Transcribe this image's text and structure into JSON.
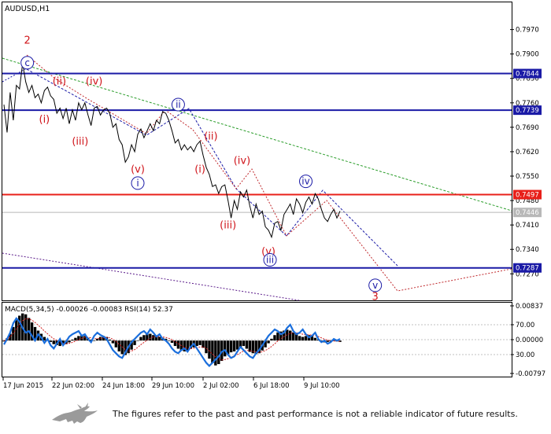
{
  "chart_data": [
    {
      "type": "line",
      "title": "AUDUSD,H1",
      "series_kind": "price (H1 candles, rendered as line)",
      "x_tick_labels": [
        "17 Jun 2015",
        "22 Jun 02:00",
        "24 Jun 18:00",
        "29 Jun 10:00",
        "2 Jul 02:00",
        "6 Jul 18:00",
        "9 Jul 10:00"
      ],
      "y_tick_labels": [
        "0.7970",
        "0.7900",
        "0.7830",
        "0.7760",
        "0.7690",
        "0.7620",
        "0.7550",
        "0.7480",
        "0.7410",
        "0.7340",
        "0.7270"
      ],
      "y_ticks": [
        0.797,
        0.79,
        0.783,
        0.776,
        0.769,
        0.762,
        0.755,
        0.748,
        0.741,
        0.734,
        0.727
      ],
      "ylim": [
        0.7194,
        0.8048
      ],
      "xlim": [
        0,
        100
      ],
      "price_path": [
        [
          0,
          0.7755
        ],
        [
          1,
          0.7675
        ],
        [
          2,
          0.779
        ],
        [
          3,
          0.771
        ],
        [
          4,
          0.781
        ],
        [
          5,
          0.78
        ],
        [
          6,
          0.7873
        ],
        [
          7,
          0.782
        ],
        [
          8,
          0.779
        ],
        [
          9,
          0.781
        ],
        [
          10,
          0.7775
        ],
        [
          11,
          0.7785
        ],
        [
          12,
          0.776
        ],
        [
          13,
          0.7795
        ],
        [
          14,
          0.7805
        ],
        [
          15,
          0.778
        ],
        [
          16,
          0.777
        ],
        [
          17,
          0.773
        ],
        [
          18,
          0.7745
        ],
        [
          19,
          0.7715
        ],
        [
          20,
          0.7745
        ],
        [
          21,
          0.77
        ],
        [
          22,
          0.774
        ],
        [
          23,
          0.771
        ],
        [
          24,
          0.776
        ],
        [
          25,
          0.774
        ],
        [
          26,
          0.776
        ],
        [
          27,
          0.7725
        ],
        [
          28,
          0.7695
        ],
        [
          29,
          0.7745
        ],
        [
          30,
          0.775
        ],
        [
          31,
          0.7725
        ],
        [
          32,
          0.774
        ],
        [
          33,
          0.7745
        ],
        [
          34,
          0.773
        ],
        [
          35,
          0.769
        ],
        [
          36,
          0.77
        ],
        [
          37,
          0.7655
        ],
        [
          38,
          0.764
        ],
        [
          39,
          0.759
        ],
        [
          40,
          0.7605
        ],
        [
          41,
          0.764
        ],
        [
          42,
          0.762
        ],
        [
          43,
          0.767
        ],
        [
          44,
          0.7685
        ],
        [
          45,
          0.766
        ],
        [
          46,
          0.768
        ],
        [
          47,
          0.77
        ],
        [
          48,
          0.768
        ],
        [
          49,
          0.771
        ],
        [
          50,
          0.77
        ],
        [
          51,
          0.7735
        ],
        [
          52,
          0.773
        ],
        [
          53,
          0.771
        ],
        [
          54,
          0.768
        ],
        [
          55,
          0.7645
        ],
        [
          56,
          0.7655
        ],
        [
          57,
          0.7625
        ],
        [
          58,
          0.764
        ],
        [
          59,
          0.7625
        ],
        [
          60,
          0.7635
        ],
        [
          61,
          0.762
        ],
        [
          62,
          0.764
        ],
        [
          63,
          0.765
        ],
        [
          64,
          0.761
        ],
        [
          65,
          0.7575
        ],
        [
          66,
          0.7555
        ],
        [
          67,
          0.752
        ],
        [
          68,
          0.7525
        ],
        [
          69,
          0.75
        ],
        [
          70,
          0.752
        ],
        [
          71,
          0.7525
        ],
        [
          72,
          0.748
        ],
        [
          73,
          0.743
        ],
        [
          74,
          0.748
        ],
        [
          75,
          0.7455
        ],
        [
          76,
          0.7505
        ],
        [
          77,
          0.749
        ],
        [
          78,
          0.751
        ],
        [
          79,
          0.7465
        ],
        [
          80,
          0.743
        ],
        [
          81,
          0.747
        ],
        [
          82,
          0.744
        ],
        [
          83,
          0.745
        ],
        [
          84,
          0.7405
        ],
        [
          85,
          0.7395
        ],
        [
          86,
          0.7375
        ],
        [
          87,
          0.7415
        ],
        [
          88,
          0.742
        ],
        [
          89,
          0.7395
        ],
        [
          90,
          0.744
        ],
        [
          91,
          0.7455
        ],
        [
          92,
          0.747
        ],
        [
          93,
          0.744
        ],
        [
          94,
          0.7485
        ],
        [
          95,
          0.747
        ],
        [
          96,
          0.7445
        ],
        [
          97,
          0.7475
        ],
        [
          98,
          0.749
        ],
        [
          99,
          0.747
        ],
        [
          100,
          0.75
        ],
        [
          101,
          0.7485
        ],
        [
          102,
          0.7455
        ],
        [
          103,
          0.743
        ],
        [
          104,
          0.742
        ],
        [
          105,
          0.744
        ],
        [
          106,
          0.7455
        ],
        [
          107,
          0.743
        ],
        [
          108,
          0.745
        ]
      ],
      "horizontal_levels": [
        {
          "value": 0.7844,
          "label": "0.7844",
          "color": "#1a1aa6"
        },
        {
          "value": 0.7739,
          "label": "0.7739",
          "color": "#1a1aa6"
        },
        {
          "value": 0.7497,
          "label": "0.7497",
          "color": "#e8201a"
        },
        {
          "value": 0.7446,
          "label": "0.7446",
          "color": "#b8b8b8"
        },
        {
          "value": 0.7287,
          "label": "0.7287",
          "color": "#1a1aa6"
        }
      ],
      "wave_labels_red": [
        {
          "text": "2",
          "x": 7.5,
          "y": 0.793
        },
        {
          "text": "(ii)",
          "x": 17.8,
          "y": 0.7813
        },
        {
          "text": "(iv)",
          "x": 29,
          "y": 0.7813
        },
        {
          "text": "(i)",
          "x": 13,
          "y": 0.7703
        },
        {
          "text": "(iii)",
          "x": 24.5,
          "y": 0.764
        },
        {
          "text": "(v)",
          "x": 43,
          "y": 0.756
        },
        {
          "text": "(ii)",
          "x": 66.5,
          "y": 0.7655
        },
        {
          "text": "(i)",
          "x": 63,
          "y": 0.756
        },
        {
          "text": "(iv)",
          "x": 76.5,
          "y": 0.7585
        },
        {
          "text": "(iii)",
          "x": 72,
          "y": 0.74
        },
        {
          "text": "(v)",
          "x": 85,
          "y": 0.7325
        },
        {
          "text": "3",
          "x": 119.3,
          "y": 0.7195
        }
      ],
      "wave_labels_blue": [
        {
          "text": "c",
          "x": 7.5,
          "y": 0.7875
        },
        {
          "text": "ii",
          "x": 56,
          "y": 0.7755
        },
        {
          "text": "i",
          "x": 43,
          "y": 0.753
        },
        {
          "text": "iv",
          "x": 97,
          "y": 0.7535
        },
        {
          "text": "iii",
          "x": 85.5,
          "y": 0.731
        },
        {
          "text": "v",
          "x": 119.3,
          "y": 0.7237
        }
      ]
    },
    {
      "type": "line",
      "title": "MACD(5,34,5) -0.00026 -0.00083 RSI(14) 52.37",
      "y_tick_labels": [
        "0.00837",
        "70.00",
        "0.00000",
        "30.00",
        "-0.00797"
      ],
      "rsi_ticks": [
        70,
        0,
        30
      ],
      "macd_ylim": [
        -0.00797,
        0.00837
      ],
      "histogram": [
        -0.0002,
        0.0005,
        0.0015,
        0.003,
        0.0045,
        0.0055,
        0.006,
        0.0058,
        0.005,
        0.004,
        0.003,
        0.0022,
        0.0015,
        0.0008,
        0.0002,
        -0.0003,
        -0.0008,
        -0.001,
        -0.0012,
        -0.001,
        -0.0008,
        -0.0004,
        0.0002,
        0.0006,
        0.001,
        0.0012,
        0.001,
        0.0006,
        0.0002,
        0.0,
        0.0004,
        0.0008,
        0.001,
        0.0008,
        0.0002,
        -0.0006,
        -0.0015,
        -0.0024,
        -0.003,
        -0.0032,
        -0.0028,
        -0.002,
        -0.001,
        0.0,
        0.0008,
        0.0012,
        0.0014,
        0.0015,
        0.0012,
        0.001,
        0.0008,
        0.0006,
        0.0004,
        0.0,
        -0.0005,
        -0.0012,
        -0.0018,
        -0.0022,
        -0.0024,
        -0.0022,
        -0.0018,
        -0.0015,
        -0.0012,
        -0.001,
        -0.0016,
        -0.0028,
        -0.004,
        -0.005,
        -0.0055,
        -0.0052,
        -0.0045,
        -0.0035,
        -0.003,
        -0.0026,
        -0.0024,
        -0.002,
        -0.0015,
        -0.0012,
        -0.0018,
        -0.0025,
        -0.0028,
        -0.003,
        -0.0028,
        -0.0022,
        -0.0015,
        -0.0006,
        0.0004,
        0.0012,
        0.0018,
        0.002,
        0.0022,
        0.0024,
        0.0022,
        0.0018,
        0.0014,
        0.001,
        0.0008,
        0.001,
        0.0012,
        0.001,
        0.0006,
        0.0002,
        -0.0002,
        -0.0004,
        -0.0003,
        -0.0002,
        -0.0001,
        -0.0002,
        -0.0003
      ],
      "signal": [
        0.0,
        0.0002,
        0.0008,
        0.0016,
        0.0026,
        0.0036,
        0.0044,
        0.0048,
        0.0048,
        0.0045,
        0.004,
        0.0034,
        0.0028,
        0.0021,
        0.0015,
        0.0009,
        0.0004,
        0.0,
        -0.0004,
        -0.0006,
        -0.0007,
        -0.0006,
        -0.0004,
        -0.0001,
        0.0002,
        0.0005,
        0.0007,
        0.0007,
        0.0006,
        0.0004,
        0.0004,
        0.0005,
        0.0006,
        0.0007,
        0.0006,
        0.0003,
        -0.0002,
        -0.0008,
        -0.0014,
        -0.002,
        -0.0023,
        -0.0023,
        -0.002,
        -0.0015,
        -0.0009,
        -0.0004,
        0.0001,
        0.0005,
        0.0008,
        0.0009,
        0.0009,
        0.0008,
        0.0007,
        0.0005,
        0.0002,
        -0.0002,
        -0.0007,
        -0.0011,
        -0.0015,
        -0.0017,
        -0.0018,
        -0.0017,
        -0.0016,
        -0.0014,
        -0.0014,
        -0.0017,
        -0.0023,
        -0.003,
        -0.0036,
        -0.0041,
        -0.0043,
        -0.0042,
        -0.004,
        -0.0037,
        -0.0034,
        -0.0031,
        -0.0027,
        -0.0023,
        -0.0022,
        -0.0022,
        -0.0024,
        -0.0025,
        -0.0026,
        -0.0025,
        -0.0022,
        -0.0018,
        -0.0013,
        -0.0007,
        -0.0001,
        0.0004,
        0.0009,
        0.0013,
        0.0016,
        0.0017,
        0.0017,
        0.0016,
        0.0014,
        0.0013,
        0.0013,
        0.0012,
        0.0011,
        0.0009,
        0.0006,
        0.0003,
        0.0001,
        0.0,
        -0.0001,
        -0.0001,
        -0.0002
      ],
      "rsi": [
        45,
        52,
        60,
        72,
        78,
        74,
        66,
        60,
        62,
        56,
        50,
        58,
        54,
        47,
        52,
        44,
        40,
        46,
        52,
        44,
        49,
        55,
        58,
        60,
        62,
        56,
        58,
        52,
        48,
        56,
        60,
        57,
        55,
        52,
        45,
        38,
        34,
        30,
        28,
        35,
        42,
        48,
        52,
        56,
        60,
        62,
        58,
        64,
        60,
        55,
        58,
        52,
        50,
        46,
        40,
        36,
        34,
        38,
        40,
        36,
        42,
        46,
        40,
        34,
        28,
        22,
        18,
        22,
        26,
        30,
        36,
        38,
        32,
        28,
        30,
        36,
        42,
        38,
        34,
        30,
        28,
        34,
        38,
        44,
        50,
        56,
        60,
        64,
        62,
        58,
        60,
        66,
        70,
        62,
        58,
        60,
        64,
        58,
        54,
        56,
        60,
        52,
        48,
        50,
        46,
        48,
        52,
        50,
        52
      ],
      "rsi_color": "#1a6edc",
      "signal_color": "#d21e1e"
    }
  ],
  "footer": {
    "disclaimer": "The figures refer to the past and past performance is not a reliable indicator of future results."
  }
}
